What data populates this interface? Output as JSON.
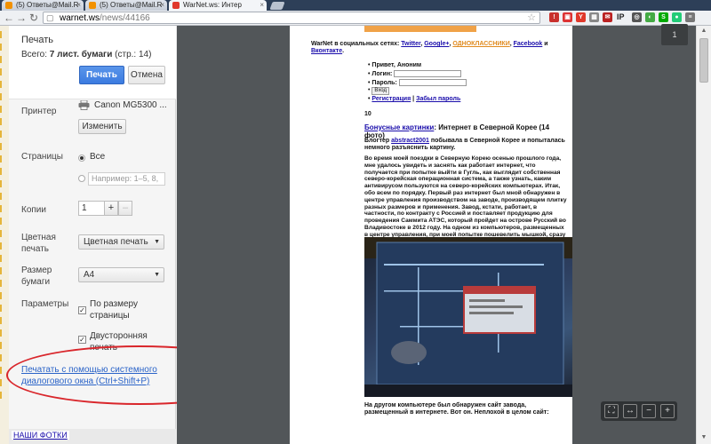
{
  "browser": {
    "tabs": [
      {
        "title": "(5) Ответы@Mail.R",
        "active": false
      },
      {
        "title": "(5) Ответы@Mail.R",
        "active": false
      },
      {
        "title": "WarNet.ws: Интер",
        "active": true
      }
    ],
    "url_host": "warnet.ws",
    "url_path": "/news/44166",
    "extensions": [
      "IP"
    ]
  },
  "print_panel": {
    "title": "Печать",
    "total_label": "Всего:",
    "total_value": "7 лист. бумаги",
    "total_pages": "(стр.: 14)",
    "print_button": "Печать",
    "cancel_button": "Отмена",
    "printer_label": "Принтер",
    "printer_name": "Canon MG5300 ...",
    "change_button": "Изменить",
    "pages_label": "Страницы",
    "pages_all": "Все",
    "pages_placeholder": "Например: 1–5, 8,",
    "copies_label": "Копии",
    "copies_value": "1",
    "color_label": "Цветная печать",
    "color_value": "Цветная печать",
    "paper_label": "Размер бумаги",
    "paper_value": "A4",
    "params_label": "Параметры",
    "fit_to_page": "По размеру страницы",
    "duplex": "Двусторонняя печать",
    "system_dialog_link": "Печатать с помощью системного диалогового окна (Ctrl+Shift+P)"
  },
  "preview": {
    "social_prefix": "WarNet в социальных сетях:",
    "social_links": [
      "Twitter",
      "Google+",
      "ОДНОКЛАССНИКИ",
      "Facebook",
      "Вконтакте"
    ],
    "login": {
      "greeting": "Привет, Аноним",
      "login_label": "Логин:",
      "password_label": "Пароль:",
      "enter_button": "Вход",
      "register_link": "Регистрация",
      "forgot_link": "Забыл пароль"
    },
    "number": "10",
    "article_link": "Бонусные картинки",
    "article_title": ": Интернет в Северной Корее (14 фото)",
    "blogger_prefix": "Блогтер",
    "blogger_name": "abstract2001",
    "blogger_text": "побывала в Северной Корее и попыталась немного разъяснить картину.",
    "body_text": "Во время моей поездки в Северную Корею осенью прошлого года, мне удалось увидеть и заснять как работает интернет, что получается при попытке выйти в Гугль, как выглядит собственная северо-корейская операционная система, а также узнать, каким антивирусом пользуются на северо-корейских компьютерах. Итак, обо всем по порядку. Первый раз интернет был мной обнаружен в центре управления производством на заводе, производящем плитку разных размеров и применения. Завод, кстати, работает, в частности, по контракту с Россией и поставляет продукцию для проведения Саммита АТЭС, который пройдет на острове Русский во Владивостоке в 2012 году. На одном из компьютеров, размещенных в центре управления, при моей попытке пошевелить мышкой, сразу выскочило предупреждение Антивируса Касперского:",
    "caption_text": "На другом компьютере был обнаружен сайт завода, размещенный в интернете. Вот он. Неплохой в целом сайт:",
    "page_badge": "1"
  },
  "background_page": {
    "link_text": "НАШИ ФОТКИ"
  },
  "colors": {
    "print_button": "#3b7be0",
    "annotation_oval": "#d9262b",
    "link": "#2a63c8",
    "orange_bar": "#f0a248"
  }
}
